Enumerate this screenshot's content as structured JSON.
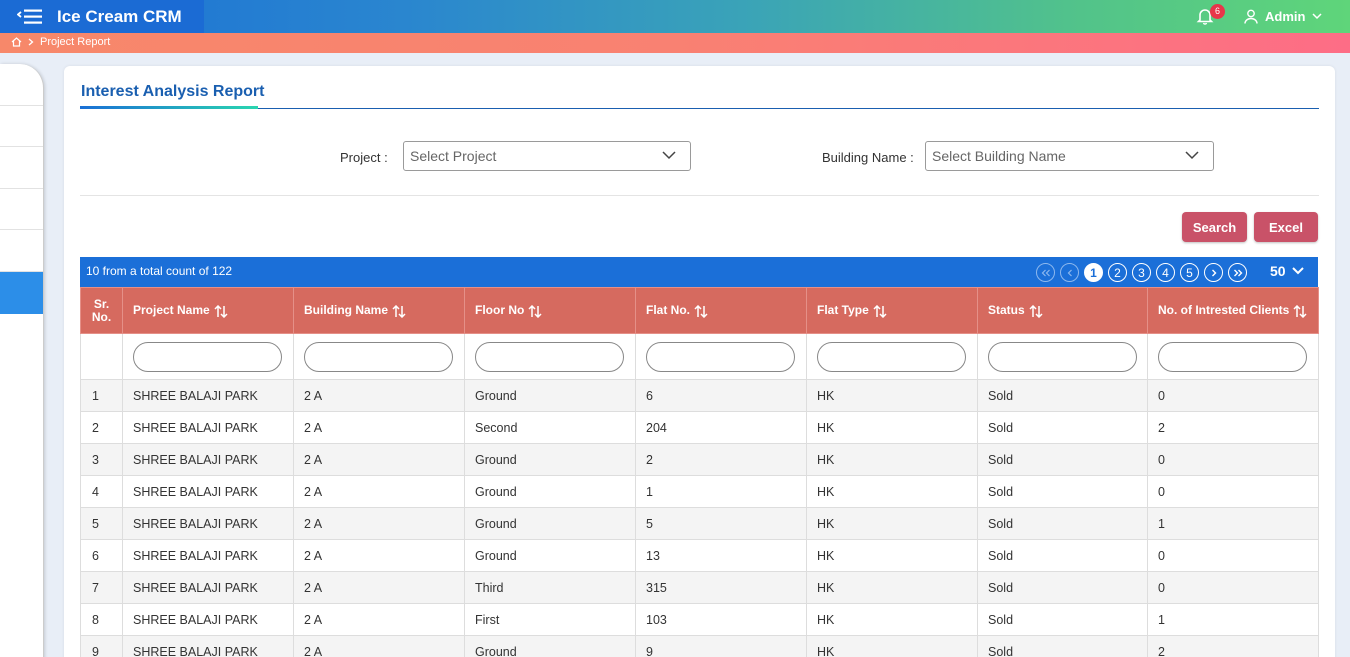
{
  "app": {
    "title": "Ice Cream CRM",
    "notifications": "6",
    "user": "Admin"
  },
  "breadcrumb": {
    "current": "Project Report"
  },
  "page": {
    "title": "Interest Analysis Report"
  },
  "filters": {
    "project_label": "Project :",
    "project_placeholder": "Select Project",
    "building_label": "Building Name :",
    "building_placeholder": "Select Building Name"
  },
  "actions": {
    "search": "Search",
    "excel": "Excel"
  },
  "table": {
    "count_text": "10 from a total count of 122",
    "pages": [
      "1",
      "2",
      "3",
      "4",
      "5"
    ],
    "current_page": "1",
    "per_page": "50",
    "headers": {
      "sr_line1": "Sr.",
      "sr_line2": "No.",
      "project": "Project Name",
      "building": "Building Name",
      "floor": "Floor No",
      "flat": "Flat No.",
      "type": "Flat Type",
      "status": "Status",
      "clients": "No. of Intrested Clients"
    },
    "rows": [
      {
        "sr": "1",
        "project": "SHREE BALAJI PARK",
        "building": "2 A",
        "floor": "Ground",
        "flat": "6",
        "type": "HK",
        "status": "Sold",
        "clients": "0"
      },
      {
        "sr": "2",
        "project": "SHREE BALAJI PARK",
        "building": "2 A",
        "floor": "Second",
        "flat": "204",
        "type": "HK",
        "status": "Sold",
        "clients": "2"
      },
      {
        "sr": "3",
        "project": "SHREE BALAJI PARK",
        "building": "2 A",
        "floor": "Ground",
        "flat": "2",
        "type": "HK",
        "status": "Sold",
        "clients": "0"
      },
      {
        "sr": "4",
        "project": "SHREE BALAJI PARK",
        "building": "2 A",
        "floor": "Ground",
        "flat": "1",
        "type": "HK",
        "status": "Sold",
        "clients": "0"
      },
      {
        "sr": "5",
        "project": "SHREE BALAJI PARK",
        "building": "2 A",
        "floor": "Ground",
        "flat": "5",
        "type": "HK",
        "status": "Sold",
        "clients": "1"
      },
      {
        "sr": "6",
        "project": "SHREE BALAJI PARK",
        "building": "2 A",
        "floor": "Ground",
        "flat": "13",
        "type": "HK",
        "status": "Sold",
        "clients": "0"
      },
      {
        "sr": "7",
        "project": "SHREE BALAJI PARK",
        "building": "2 A",
        "floor": "Third",
        "flat": "315",
        "type": "HK",
        "status": "Sold",
        "clients": "0"
      },
      {
        "sr": "8",
        "project": "SHREE BALAJI PARK",
        "building": "2 A",
        "floor": "First",
        "flat": "103",
        "type": "HK",
        "status": "Sold",
        "clients": "1"
      },
      {
        "sr": "9",
        "project": "SHREE BALAJI PARK",
        "building": "2 A",
        "floor": "Ground",
        "flat": "9",
        "type": "HK",
        "status": "Sold",
        "clients": "2"
      }
    ]
  }
}
